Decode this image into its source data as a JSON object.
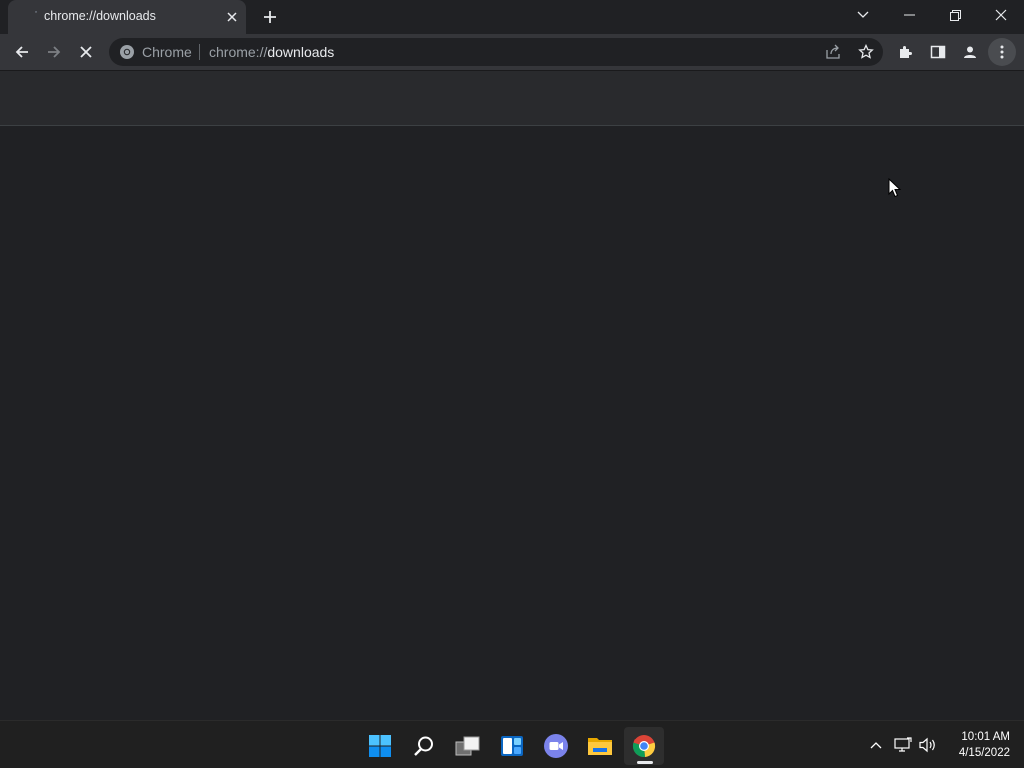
{
  "browser": {
    "tab": {
      "title": "chrome://downloads"
    },
    "omnibox": {
      "origin_label": "Chrome",
      "url_scheme": "chrome://",
      "url_host": "downloads"
    }
  },
  "taskbar": {
    "apps": [
      "start",
      "search",
      "task-view",
      "widgets",
      "teams-chat",
      "file-explorer",
      "chrome"
    ],
    "clock": {
      "time": "10:01 AM",
      "date": "4/15/2022"
    }
  },
  "colors": {
    "window_bg": "#202124",
    "toolbar_bg": "#35363a",
    "header_bg": "#292a2d",
    "taskbar_bg": "#202020",
    "chrome_active_indicator": "#e8eaed"
  }
}
